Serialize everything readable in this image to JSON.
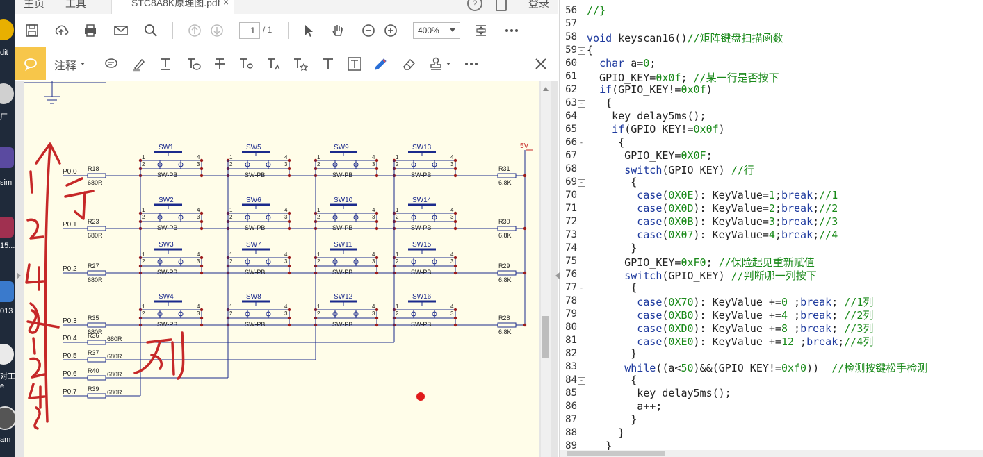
{
  "desktop": {
    "labels": [
      "dit",
      "厂",
      "sim",
      "15...",
      "013",
      "对工",
      "e",
      "am"
    ]
  },
  "pdf": {
    "tabs": {
      "home": "主页",
      "tools": "工具",
      "file": "STC8A8K原理图.pdf",
      "close": "×",
      "login": "登录"
    },
    "toolbar": {
      "page_value": "1",
      "page_total": "/ 1",
      "zoom": "400%"
    },
    "annot": {
      "label": "注释"
    },
    "schematic": {
      "vcc": "5V",
      "switch_part": "SW-PB",
      "rows": [
        {
          "port": "P0.0",
          "res": "R18",
          "val": "680R",
          "pull": "R31",
          "pull_val": "6.8K",
          "switches": [
            "SW1",
            "SW5",
            "SW9",
            "SW13"
          ]
        },
        {
          "port": "P0.1",
          "res": "R23",
          "val": "680R",
          "pull": "R30",
          "pull_val": "6.8K",
          "switches": [
            "SW2",
            "SW6",
            "SW10",
            "SW14"
          ]
        },
        {
          "port": "P0.2",
          "res": "R27",
          "val": "680R",
          "pull": "R29",
          "pull_val": "6.8K",
          "switches": [
            "SW3",
            "SW7",
            "SW11",
            "SW15"
          ]
        },
        {
          "port": "P0.3",
          "res": "R35",
          "val": "680R",
          "pull": "R28",
          "pull_val": "6.8K",
          "switches": [
            "SW4",
            "SW8",
            "SW12",
            "SW16"
          ]
        }
      ],
      "cols": [
        {
          "port": "P0.4",
          "res": "R36",
          "val": "680R"
        },
        {
          "port": "P0.5",
          "res": "R37",
          "val": "680R"
        },
        {
          "port": "P0.6",
          "res": "R40",
          "val": "680R"
        },
        {
          "port": "P0.7",
          "res": "R39",
          "val": "680R"
        }
      ],
      "pins": [
        "1",
        "2",
        "3",
        "4"
      ],
      "handwriting_row": "1 2 4 8 行",
      "handwriting_col": "1 2 4 8 列"
    }
  },
  "editor": {
    "lines": [
      {
        "n": "56",
        "t": [
          [
            "cm",
            "//}"
          ]
        ]
      },
      {
        "n": "57",
        "t": [
          [
            "cm",
            ""
          ]
        ]
      },
      {
        "n": "58",
        "t": [
          [
            "kw",
            "void"
          ],
          [
            "pl",
            " keyscan16()"
          ],
          [
            "cm",
            "//矩阵键盘扫描函数"
          ]
        ]
      },
      {
        "n": "59",
        "fold": "-",
        "t": [
          [
            "pl",
            "{"
          ]
        ]
      },
      {
        "n": "60",
        "t": [
          [
            "pl",
            "  "
          ],
          [
            "kw",
            "char"
          ],
          [
            "pl",
            " a="
          ],
          [
            "nm",
            "0"
          ],
          [
            "pl",
            ";"
          ]
        ]
      },
      {
        "n": "61",
        "t": [
          [
            "pl",
            "  GPIO_KEY="
          ],
          [
            "nm",
            "0x0f"
          ],
          [
            "pl",
            "; "
          ],
          [
            "cm",
            "//某一行是否按下"
          ]
        ]
      },
      {
        "n": "62",
        "t": [
          [
            "pl",
            "  "
          ],
          [
            "kw",
            "if"
          ],
          [
            "pl",
            "(GPIO_KEY!="
          ],
          [
            "nm",
            "0x0f"
          ],
          [
            "pl",
            ")"
          ]
        ]
      },
      {
        "n": "63",
        "fold": "-",
        "t": [
          [
            "pl",
            "   {"
          ]
        ]
      },
      {
        "n": "64",
        "t": [
          [
            "pl",
            "    key_delay5ms();"
          ]
        ]
      },
      {
        "n": "65",
        "t": [
          [
            "pl",
            "    "
          ],
          [
            "kw",
            "if"
          ],
          [
            "pl",
            "(GPIO_KEY!="
          ],
          [
            "nm",
            "0x0f"
          ],
          [
            "pl",
            ")"
          ]
        ]
      },
      {
        "n": "66",
        "fold": "-",
        "t": [
          [
            "pl",
            "     {"
          ]
        ]
      },
      {
        "n": "67",
        "t": [
          [
            "pl",
            "      GPIO_KEY="
          ],
          [
            "nm",
            "0X0F"
          ],
          [
            "pl",
            ";"
          ]
        ]
      },
      {
        "n": "68",
        "t": [
          [
            "pl",
            "      "
          ],
          [
            "kw",
            "switch"
          ],
          [
            "pl",
            "(GPIO_KEY) "
          ],
          [
            "cm",
            "//行"
          ]
        ]
      },
      {
        "n": "69",
        "fold": "-",
        "t": [
          [
            "pl",
            "       {"
          ]
        ]
      },
      {
        "n": "70",
        "t": [
          [
            "pl",
            "        "
          ],
          [
            "kw",
            "case"
          ],
          [
            "pl",
            "("
          ],
          [
            "nm",
            "0X0E"
          ],
          [
            "pl",
            "): KeyValue="
          ],
          [
            "nm",
            "1"
          ],
          [
            "pl",
            ";"
          ],
          [
            "kw",
            "break"
          ],
          [
            "pl",
            ";"
          ],
          [
            "cm",
            "//1"
          ]
        ]
      },
      {
        "n": "71",
        "t": [
          [
            "pl",
            "        "
          ],
          [
            "kw",
            "case"
          ],
          [
            "pl",
            "("
          ],
          [
            "nm",
            "0X0D"
          ],
          [
            "pl",
            "): KeyValue="
          ],
          [
            "nm",
            "2"
          ],
          [
            "pl",
            ";"
          ],
          [
            "kw",
            "break"
          ],
          [
            "pl",
            ";"
          ],
          [
            "cm",
            "//2"
          ]
        ]
      },
      {
        "n": "72",
        "t": [
          [
            "pl",
            "        "
          ],
          [
            "kw",
            "case"
          ],
          [
            "pl",
            "("
          ],
          [
            "nm",
            "0X0B"
          ],
          [
            "pl",
            "): KeyValue="
          ],
          [
            "nm",
            "3"
          ],
          [
            "pl",
            ";"
          ],
          [
            "kw",
            "break"
          ],
          [
            "pl",
            ";"
          ],
          [
            "cm",
            "//3"
          ]
        ]
      },
      {
        "n": "73",
        "t": [
          [
            "pl",
            "        "
          ],
          [
            "kw",
            "case"
          ],
          [
            "pl",
            "("
          ],
          [
            "nm",
            "0X07"
          ],
          [
            "pl",
            "): KeyValue="
          ],
          [
            "nm",
            "4"
          ],
          [
            "pl",
            ";"
          ],
          [
            "kw",
            "break"
          ],
          [
            "pl",
            ";"
          ],
          [
            "cm",
            "//4"
          ]
        ]
      },
      {
        "n": "74",
        "t": [
          [
            "pl",
            "       }"
          ]
        ]
      },
      {
        "n": "75",
        "t": [
          [
            "pl",
            "      GPIO_KEY="
          ],
          [
            "nm",
            "0xF0"
          ],
          [
            "pl",
            "; "
          ],
          [
            "cm",
            "//保险起见重新赋值"
          ]
        ]
      },
      {
        "n": "76",
        "t": [
          [
            "pl",
            "      "
          ],
          [
            "kw",
            "switch"
          ],
          [
            "pl",
            "(GPIO_KEY) "
          ],
          [
            "cm",
            "//判断哪一列按下"
          ]
        ]
      },
      {
        "n": "77",
        "fold": "-",
        "t": [
          [
            "pl",
            "       {"
          ]
        ]
      },
      {
        "n": "78",
        "t": [
          [
            "pl",
            "        "
          ],
          [
            "kw",
            "case"
          ],
          [
            "pl",
            "("
          ],
          [
            "nm",
            "0X70"
          ],
          [
            "pl",
            "): KeyValue +="
          ],
          [
            "nm",
            "0"
          ],
          [
            "pl",
            " ;"
          ],
          [
            "kw",
            "break"
          ],
          [
            "pl",
            "; "
          ],
          [
            "cm",
            "//1列"
          ]
        ]
      },
      {
        "n": "79",
        "t": [
          [
            "pl",
            "        "
          ],
          [
            "kw",
            "case"
          ],
          [
            "pl",
            "("
          ],
          [
            "nm",
            "0XB0"
          ],
          [
            "pl",
            "): KeyValue +="
          ],
          [
            "nm",
            "4"
          ],
          [
            "pl",
            " ;"
          ],
          [
            "kw",
            "break"
          ],
          [
            "pl",
            "; "
          ],
          [
            "cm",
            "//2列"
          ]
        ]
      },
      {
        "n": "80",
        "t": [
          [
            "pl",
            "        "
          ],
          [
            "kw",
            "case"
          ],
          [
            "pl",
            "("
          ],
          [
            "nm",
            "0XD0"
          ],
          [
            "pl",
            "): KeyValue +="
          ],
          [
            "nm",
            "8"
          ],
          [
            "pl",
            " ;"
          ],
          [
            "kw",
            "break"
          ],
          [
            "pl",
            "; "
          ],
          [
            "cm",
            "//3列"
          ]
        ]
      },
      {
        "n": "81",
        "t": [
          [
            "pl",
            "        "
          ],
          [
            "kw",
            "case"
          ],
          [
            "pl",
            "("
          ],
          [
            "nm",
            "0XE0"
          ],
          [
            "pl",
            "): KeyValue +="
          ],
          [
            "nm",
            "12"
          ],
          [
            "pl",
            " ;"
          ],
          [
            "kw",
            "break"
          ],
          [
            "pl",
            ";"
          ],
          [
            "cm",
            "//4列"
          ]
        ]
      },
      {
        "n": "82",
        "t": [
          [
            "pl",
            "       }"
          ]
        ]
      },
      {
        "n": "83",
        "t": [
          [
            "pl",
            "      "
          ],
          [
            "kw",
            "while"
          ],
          [
            "pl",
            "((a<"
          ],
          [
            "nm",
            "50"
          ],
          [
            "pl",
            ")&&(GPIO_KEY!="
          ],
          [
            "nm",
            "0xf0"
          ],
          [
            "pl",
            "))  "
          ],
          [
            "cm",
            "//检测按键松手检测"
          ]
        ]
      },
      {
        "n": "84",
        "fold": "-",
        "t": [
          [
            "pl",
            "       {"
          ]
        ]
      },
      {
        "n": "85",
        "t": [
          [
            "pl",
            "        key_delay5ms();"
          ]
        ]
      },
      {
        "n": "86",
        "t": [
          [
            "pl",
            "        a++;"
          ]
        ]
      },
      {
        "n": "87",
        "t": [
          [
            "pl",
            "       }"
          ]
        ]
      },
      {
        "n": "88",
        "t": [
          [
            "pl",
            "     }"
          ]
        ]
      },
      {
        "n": "89",
        "t": [
          [
            "pl",
            "   }"
          ]
        ]
      }
    ]
  }
}
